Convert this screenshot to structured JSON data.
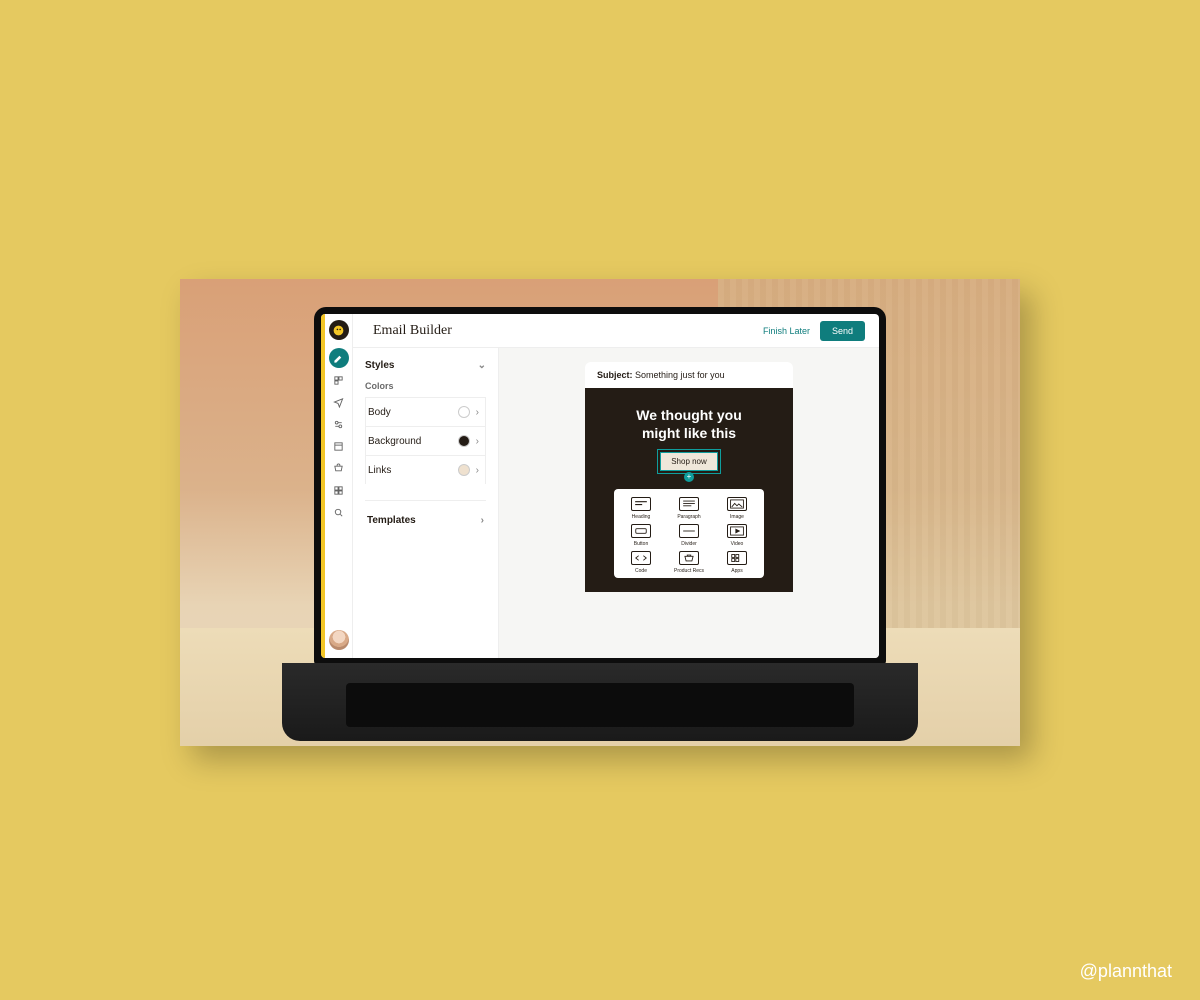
{
  "watermark": "@plannthat",
  "app": {
    "title": "Email Builder",
    "finish_later": "Finish Later",
    "send": "Send"
  },
  "panel": {
    "styles_label": "Styles",
    "colors_label": "Colors",
    "rows": [
      {
        "label": "Body",
        "swatch": "#ffffff"
      },
      {
        "label": "Background",
        "swatch": "#241c15"
      },
      {
        "label": "Links",
        "swatch": "#efe1cf"
      }
    ],
    "templates_label": "Templates"
  },
  "email": {
    "subject_prefix": "Subject:",
    "subject_text": "Something just for you",
    "headline_line1": "We thought you",
    "headline_line2": "might like this",
    "cta": "Shop now"
  },
  "blocks": [
    {
      "label": "Heading",
      "icon": "heading"
    },
    {
      "label": "Paragraph",
      "icon": "paragraph"
    },
    {
      "label": "Image",
      "icon": "image"
    },
    {
      "label": "Button",
      "icon": "button"
    },
    {
      "label": "Divider",
      "icon": "divider"
    },
    {
      "label": "Video",
      "icon": "video"
    },
    {
      "label": "Code",
      "icon": "code"
    },
    {
      "label": "Product Recs",
      "icon": "product"
    },
    {
      "label": "Apps",
      "icon": "apps"
    }
  ],
  "colors": {
    "accent_teal": "#0f7d7d",
    "brand_dark": "#241c15",
    "outer_bg": "#e5c960"
  }
}
